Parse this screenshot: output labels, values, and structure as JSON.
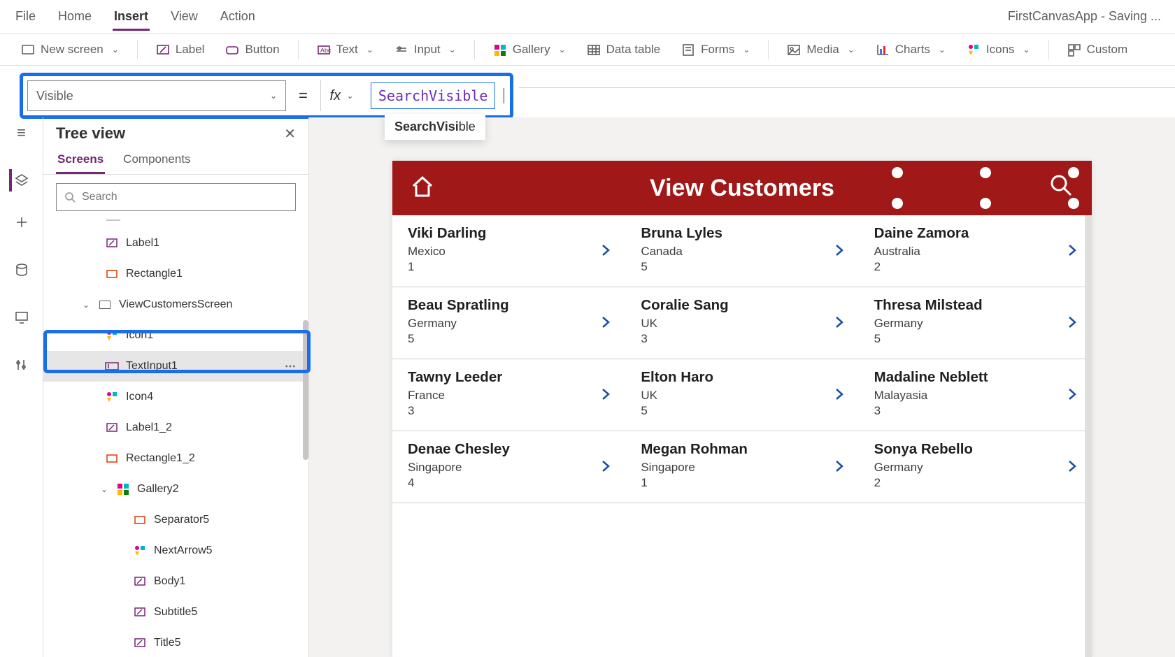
{
  "menubar": {
    "items": [
      "File",
      "Home",
      "Insert",
      "View",
      "Action"
    ],
    "active_index": 2,
    "apptitle": "FirstCanvasApp - Saving ..."
  },
  "ribbon": {
    "newscreen": "New screen",
    "label": "Label",
    "button": "Button",
    "text": "Text",
    "input": "Input",
    "gallery": "Gallery",
    "datatable": "Data table",
    "forms": "Forms",
    "media": "Media",
    "charts": "Charts",
    "icons": "Icons",
    "custom": "Custom"
  },
  "propbar": {
    "property": "Visible",
    "fx": "fx",
    "formula": "SearchVisible"
  },
  "intellisense": {
    "bold": "SearchVisi",
    "rest": "ble"
  },
  "treepanel": {
    "title": "Tree view",
    "tabs": {
      "screens": "Screens",
      "components": "Components"
    },
    "search_placeholder": "Search",
    "nodes": {
      "label1": "Label1",
      "rect1": "Rectangle1",
      "vcs": "ViewCustomersScreen",
      "icon1": "Icon1",
      "textinput1": "TextInput1",
      "icon4": "Icon4",
      "label1_2": "Label1_2",
      "rect1_2": "Rectangle1_2",
      "gallery2": "Gallery2",
      "sep5": "Separator5",
      "nextarrow5": "NextArrow5",
      "body1": "Body1",
      "subtitle5": "Subtitle5",
      "title5": "Title5"
    }
  },
  "appscreen": {
    "title": "View Customers",
    "customers": [
      [
        {
          "name": "Viki  Darling",
          "country": "Mexico",
          "num": "1"
        },
        {
          "name": "Bruna  Lyles",
          "country": "Canada",
          "num": "5"
        },
        {
          "name": "Daine  Zamora",
          "country": "Australia",
          "num": "2"
        }
      ],
      [
        {
          "name": "Beau  Spratling",
          "country": "Germany",
          "num": "5"
        },
        {
          "name": "Coralie  Sang",
          "country": "UK",
          "num": "3"
        },
        {
          "name": "Thresa  Milstead",
          "country": "Germany",
          "num": "5"
        }
      ],
      [
        {
          "name": "Tawny  Leeder",
          "country": "France",
          "num": "3"
        },
        {
          "name": "Elton  Haro",
          "country": "UK",
          "num": "5"
        },
        {
          "name": "Madaline  Neblett",
          "country": "Malayasia",
          "num": "3"
        }
      ],
      [
        {
          "name": "Denae  Chesley",
          "country": "Singapore",
          "num": "4"
        },
        {
          "name": "Megan  Rohman",
          "country": "Singapore",
          "num": "1"
        },
        {
          "name": "Sonya  Rebello",
          "country": "Germany",
          "num": "2"
        }
      ]
    ]
  }
}
